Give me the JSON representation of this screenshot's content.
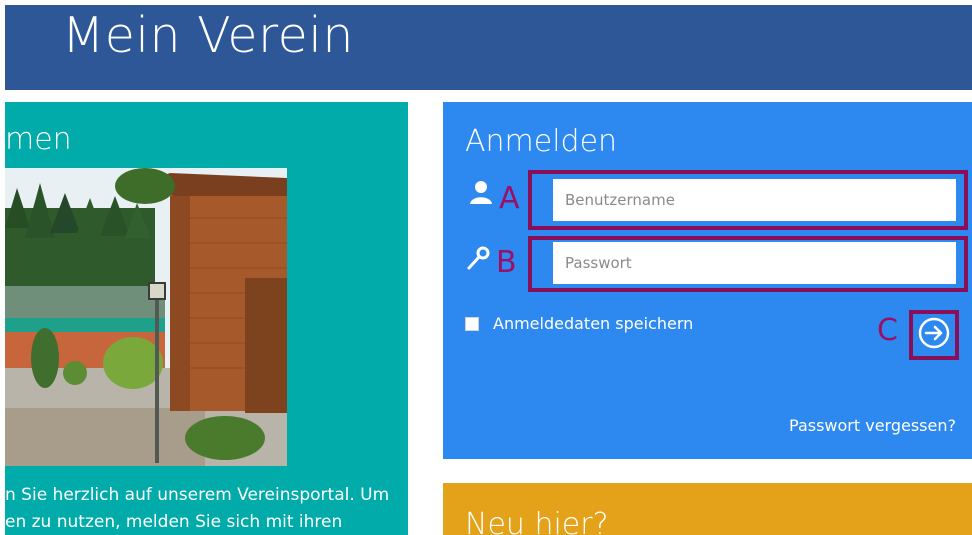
{
  "header": {
    "title": "Mein Verein"
  },
  "welcome": {
    "heading": "men",
    "line1": "n Sie herzlich auf unserem Vereinsportal. Um",
    "line2": "en zu nutzen, melden Sie sich mit ihren"
  },
  "login": {
    "heading": "Anmelden",
    "username_placeholder": "Benutzername",
    "password_placeholder": "Passwort",
    "remember_label": "Anmeldedaten speichern",
    "forgot_label": "Passwort vergessen?",
    "markers": {
      "a": "A",
      "b": "B",
      "c": "C"
    },
    "icons": {
      "user": "user-icon",
      "key": "key-icon",
      "submit": "arrow-right-circle-icon"
    }
  },
  "new_here": {
    "heading": "Neu hier?"
  },
  "colors": {
    "header_bg": "#2d5797",
    "welcome_bg": "#00aba9",
    "login_bg": "#2d89ef",
    "new_here_bg": "#e3a21a",
    "annotation": "#8a0f59"
  }
}
